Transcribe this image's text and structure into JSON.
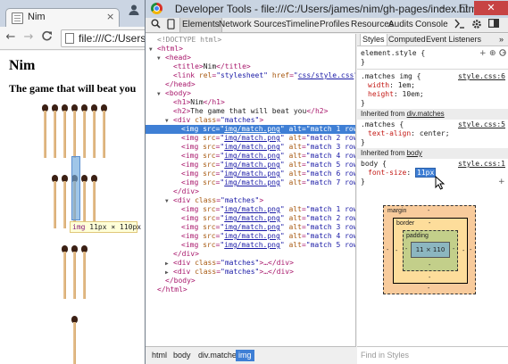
{
  "browser": {
    "tab_title": "Nim",
    "tab_close": "×",
    "url": "file:///C:/Users/james/nim/gh-pages/index.html",
    "back_icon": "←",
    "forward_icon": "→",
    "reload_icon": "C",
    "user_icon": "👤"
  },
  "page": {
    "h1": "Nim",
    "h2": "The game that will beat you",
    "rows": [
      {
        "count": 7
      },
      {
        "count": 5
      },
      {
        "count": 3
      },
      {
        "count": 1
      }
    ],
    "tooltip_tag": "img",
    "tooltip_size": "11px × 110px"
  },
  "devtools": {
    "title": "Developer Tools - file:///C:/Users/james/nim/gh-pages/index.html",
    "window_buttons": [
      "–",
      "□",
      "✕"
    ],
    "panel_tabs": [
      "Elements",
      "Network",
      "Sources",
      "Timeline",
      "Profiles",
      "Resources",
      "Audits",
      "Console"
    ],
    "active_panel": "Elements",
    "tree_rows": [
      {
        "indent": 0,
        "arrow": "",
        "parts": [
          [
            "cmt",
            "<!DOCTYPE html>"
          ]
        ]
      },
      {
        "indent": 0,
        "arrow": "▼",
        "parts": [
          [
            "tag",
            "<html>"
          ]
        ]
      },
      {
        "indent": 1,
        "arrow": "▼",
        "parts": [
          [
            "tag",
            "<head>"
          ]
        ]
      },
      {
        "indent": 2,
        "arrow": "",
        "parts": [
          [
            "tag",
            "<title>"
          ],
          [
            "txt",
            "Nim"
          ],
          [
            "tag",
            "</title>"
          ]
        ]
      },
      {
        "indent": 2,
        "arrow": "",
        "parts": [
          [
            "tag",
            "<link "
          ],
          [
            "an",
            "rel"
          ],
          [
            "tag",
            "="
          ],
          [
            "av",
            "\"stylesheet\""
          ],
          [
            "tag",
            " "
          ],
          [
            "an",
            "href"
          ],
          [
            "tag",
            "="
          ],
          [
            "av",
            "\""
          ],
          [
            "al",
            "css/style.css"
          ],
          [
            "av",
            "\""
          ],
          [
            "tag",
            ">"
          ]
        ]
      },
      {
        "indent": 1,
        "arrow": "",
        "parts": [
          [
            "tag",
            "</head>"
          ]
        ]
      },
      {
        "indent": 1,
        "arrow": "▼",
        "parts": [
          [
            "tag",
            "<body>"
          ]
        ]
      },
      {
        "indent": 2,
        "arrow": "",
        "parts": [
          [
            "tag",
            "<h1>"
          ],
          [
            "txt",
            "Nim"
          ],
          [
            "tag",
            "</h1>"
          ]
        ]
      },
      {
        "indent": 2,
        "arrow": "",
        "parts": [
          [
            "tag",
            "<h2>"
          ],
          [
            "txt",
            "The game that will beat you"
          ],
          [
            "tag",
            "</h2>"
          ]
        ]
      },
      {
        "indent": 2,
        "arrow": "▼",
        "parts": [
          [
            "tag",
            "<div "
          ],
          [
            "an",
            "class"
          ],
          [
            "tag",
            "="
          ],
          [
            "av",
            "\"matches\""
          ],
          [
            "tag",
            ">"
          ]
        ]
      },
      {
        "indent": 3,
        "arrow": "",
        "selected": true,
        "parts": [
          [
            "tag",
            "<img "
          ],
          [
            "an",
            "src"
          ],
          [
            "tag",
            "="
          ],
          [
            "av",
            "\""
          ],
          [
            "al",
            "img/match.png"
          ],
          [
            "av",
            "\""
          ],
          [
            "tag",
            " "
          ],
          [
            "an",
            "alt"
          ],
          [
            "tag",
            "="
          ],
          [
            "av",
            "\"match 1 row 1\""
          ],
          [
            "tag",
            ">"
          ]
        ]
      },
      {
        "indent": 3,
        "arrow": "",
        "parts": [
          [
            "tag",
            "<img "
          ],
          [
            "an",
            "src"
          ],
          [
            "tag",
            "="
          ],
          [
            "av",
            "\""
          ],
          [
            "al",
            "img/match.png"
          ],
          [
            "av",
            "\""
          ],
          [
            "tag",
            " "
          ],
          [
            "an",
            "alt"
          ],
          [
            "tag",
            "="
          ],
          [
            "av",
            "\"match 2 row 1\""
          ],
          [
            "tag",
            ">"
          ]
        ]
      },
      {
        "indent": 3,
        "arrow": "",
        "parts": [
          [
            "tag",
            "<img "
          ],
          [
            "an",
            "src"
          ],
          [
            "tag",
            "="
          ],
          [
            "av",
            "\""
          ],
          [
            "al",
            "img/match.png"
          ],
          [
            "av",
            "\""
          ],
          [
            "tag",
            " "
          ],
          [
            "an",
            "alt"
          ],
          [
            "tag",
            "="
          ],
          [
            "av",
            "\"match 3 row 1\""
          ],
          [
            "tag",
            ">"
          ]
        ]
      },
      {
        "indent": 3,
        "arrow": "",
        "parts": [
          [
            "tag",
            "<img "
          ],
          [
            "an",
            "src"
          ],
          [
            "tag",
            "="
          ],
          [
            "av",
            "\""
          ],
          [
            "al",
            "img/match.png"
          ],
          [
            "av",
            "\""
          ],
          [
            "tag",
            " "
          ],
          [
            "an",
            "alt"
          ],
          [
            "tag",
            "="
          ],
          [
            "av",
            "\"match 4 row 1\""
          ],
          [
            "tag",
            ">"
          ]
        ]
      },
      {
        "indent": 3,
        "arrow": "",
        "parts": [
          [
            "tag",
            "<img "
          ],
          [
            "an",
            "src"
          ],
          [
            "tag",
            "="
          ],
          [
            "av",
            "\""
          ],
          [
            "al",
            "img/match.png"
          ],
          [
            "av",
            "\""
          ],
          [
            "tag",
            " "
          ],
          [
            "an",
            "alt"
          ],
          [
            "tag",
            "="
          ],
          [
            "av",
            "\"match 5 row 1\""
          ],
          [
            "tag",
            ">"
          ]
        ]
      },
      {
        "indent": 3,
        "arrow": "",
        "parts": [
          [
            "tag",
            "<img "
          ],
          [
            "an",
            "src"
          ],
          [
            "tag",
            "="
          ],
          [
            "av",
            "\""
          ],
          [
            "al",
            "img/match.png"
          ],
          [
            "av",
            "\""
          ],
          [
            "tag",
            " "
          ],
          [
            "an",
            "alt"
          ],
          [
            "tag",
            "="
          ],
          [
            "av",
            "\"match 6 row 1\""
          ],
          [
            "tag",
            ">"
          ]
        ]
      },
      {
        "indent": 3,
        "arrow": "",
        "parts": [
          [
            "tag",
            "<img "
          ],
          [
            "an",
            "src"
          ],
          [
            "tag",
            "="
          ],
          [
            "av",
            "\""
          ],
          [
            "al",
            "img/match.png"
          ],
          [
            "av",
            "\""
          ],
          [
            "tag",
            " "
          ],
          [
            "an",
            "alt"
          ],
          [
            "tag",
            "="
          ],
          [
            "av",
            "\"match 7 row 1\""
          ],
          [
            "tag",
            ">"
          ]
        ]
      },
      {
        "indent": 2,
        "arrow": "",
        "parts": [
          [
            "tag",
            "</div>"
          ]
        ]
      },
      {
        "indent": 2,
        "arrow": "▼",
        "parts": [
          [
            "tag",
            "<div "
          ],
          [
            "an",
            "class"
          ],
          [
            "tag",
            "="
          ],
          [
            "av",
            "\"matches\""
          ],
          [
            "tag",
            ">"
          ]
        ]
      },
      {
        "indent": 3,
        "arrow": "",
        "parts": [
          [
            "tag",
            "<img "
          ],
          [
            "an",
            "src"
          ],
          [
            "tag",
            "="
          ],
          [
            "av",
            "\""
          ],
          [
            "al",
            "img/match.png"
          ],
          [
            "av",
            "\""
          ],
          [
            "tag",
            " "
          ],
          [
            "an",
            "alt"
          ],
          [
            "tag",
            "="
          ],
          [
            "av",
            "\"match 1 row 2\""
          ],
          [
            "tag",
            ">"
          ]
        ]
      },
      {
        "indent": 3,
        "arrow": "",
        "parts": [
          [
            "tag",
            "<img "
          ],
          [
            "an",
            "src"
          ],
          [
            "tag",
            "="
          ],
          [
            "av",
            "\""
          ],
          [
            "al",
            "img/match.png"
          ],
          [
            "av",
            "\""
          ],
          [
            "tag",
            " "
          ],
          [
            "an",
            "alt"
          ],
          [
            "tag",
            "="
          ],
          [
            "av",
            "\"match 2 row 2\""
          ],
          [
            "tag",
            ">"
          ]
        ]
      },
      {
        "indent": 3,
        "arrow": "",
        "parts": [
          [
            "tag",
            "<img "
          ],
          [
            "an",
            "src"
          ],
          [
            "tag",
            "="
          ],
          [
            "av",
            "\""
          ],
          [
            "al",
            "img/match.png"
          ],
          [
            "av",
            "\""
          ],
          [
            "tag",
            " "
          ],
          [
            "an",
            "alt"
          ],
          [
            "tag",
            "="
          ],
          [
            "av",
            "\"match 3 row 2\""
          ],
          [
            "tag",
            ">"
          ]
        ]
      },
      {
        "indent": 3,
        "arrow": "",
        "parts": [
          [
            "tag",
            "<img "
          ],
          [
            "an",
            "src"
          ],
          [
            "tag",
            "="
          ],
          [
            "av",
            "\""
          ],
          [
            "al",
            "img/match.png"
          ],
          [
            "av",
            "\""
          ],
          [
            "tag",
            " "
          ],
          [
            "an",
            "alt"
          ],
          [
            "tag",
            "="
          ],
          [
            "av",
            "\"match 4 row 2\""
          ],
          [
            "tag",
            ">"
          ]
        ]
      },
      {
        "indent": 3,
        "arrow": "",
        "parts": [
          [
            "tag",
            "<img "
          ],
          [
            "an",
            "src"
          ],
          [
            "tag",
            "="
          ],
          [
            "av",
            "\""
          ],
          [
            "al",
            "img/match.png"
          ],
          [
            "av",
            "\""
          ],
          [
            "tag",
            " "
          ],
          [
            "an",
            "alt"
          ],
          [
            "tag",
            "="
          ],
          [
            "av",
            "\"match 5 row 2\""
          ],
          [
            "tag",
            ">"
          ]
        ]
      },
      {
        "indent": 2,
        "arrow": "",
        "parts": [
          [
            "tag",
            "</div>"
          ]
        ]
      },
      {
        "indent": 2,
        "arrow": "▶",
        "parts": [
          [
            "tag",
            "<div "
          ],
          [
            "an",
            "class"
          ],
          [
            "tag",
            "="
          ],
          [
            "av",
            "\"matches\""
          ],
          [
            "tag",
            ">…</div>"
          ]
        ]
      },
      {
        "indent": 2,
        "arrow": "▶",
        "parts": [
          [
            "tag",
            "<div "
          ],
          [
            "an",
            "class"
          ],
          [
            "tag",
            "="
          ],
          [
            "av",
            "\"matches\""
          ],
          [
            "tag",
            ">…</div>"
          ]
        ]
      },
      {
        "indent": 1,
        "arrow": "",
        "parts": [
          [
            "tag",
            "</body>"
          ]
        ]
      },
      {
        "indent": 0,
        "arrow": "",
        "parts": [
          [
            "tag",
            "</html>"
          ]
        ]
      }
    ],
    "breadcrumbs": [
      "html",
      "body",
      "div.matches",
      "img"
    ],
    "active_breadcrumb": "img",
    "styles": {
      "subtabs": [
        "Styles",
        "Computed",
        "Event Listeners",
        "»"
      ],
      "active_subtab": "Styles",
      "element_style": "element.style {",
      "close_brace": "}",
      "rule1_selector": ".matches img {",
      "rule1_source": "style.css:6",
      "rule1_props": [
        {
          "name": "width",
          "value": "1em;"
        },
        {
          "name": "height",
          "value": "10em;"
        }
      ],
      "inherited_1": "Inherited from ",
      "inherited_1_link": "div.matches",
      "rule2_selector": ".matches {",
      "rule2_source": "style.css:5",
      "rule2_props": [
        {
          "name": "text-align",
          "value": "center;"
        }
      ],
      "inherited_2": "Inherited from ",
      "inherited_2_link": "body",
      "rule3_selector": "body {",
      "rule3_source": "style.css:1",
      "rule3_prop": "font-size",
      "rule3_value": "11px",
      "add_icon": "+",
      "toggle_icon": "⊕",
      "box_model": {
        "margin_label": "margin",
        "border_label": "border",
        "padding_label": "padding",
        "content": "11 × 110",
        "dash": "-"
      },
      "find_placeholder": "Find in Styles"
    }
  }
}
